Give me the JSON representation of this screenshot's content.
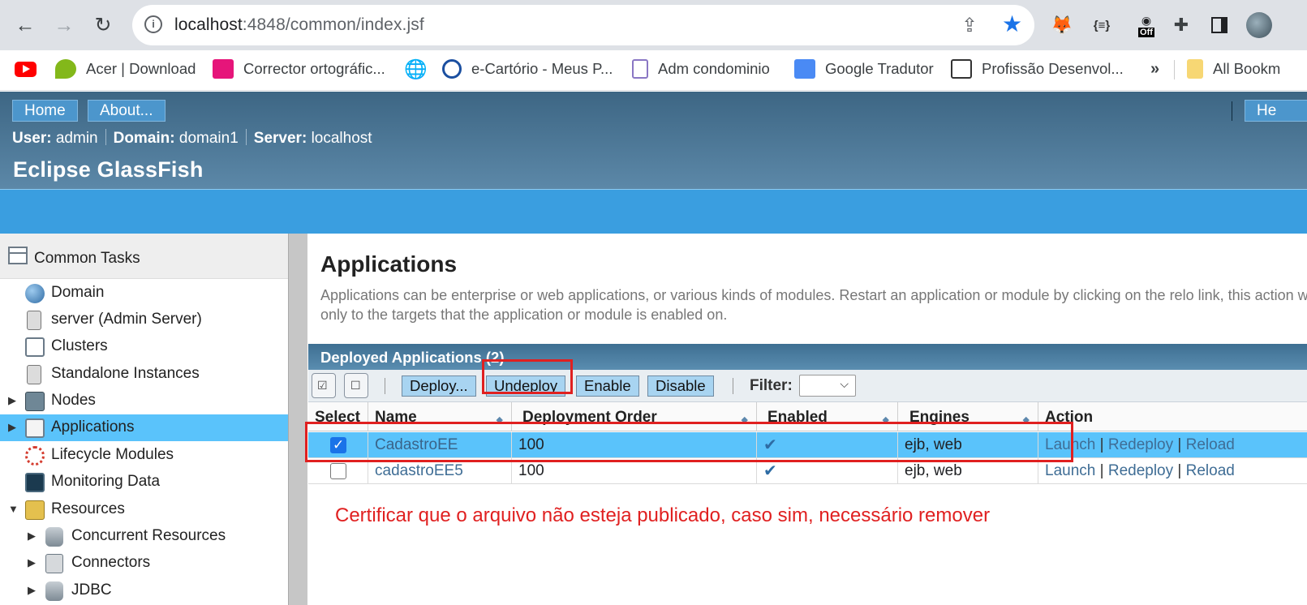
{
  "browser": {
    "url_host": "localhost",
    "url_rest": ":4848/common/index.jsf",
    "bookmarks": [
      {
        "label": "Acer | Download",
        "color": "#83b81a"
      },
      {
        "label": "Corrector ortográfic...",
        "color": "#e6157a"
      },
      {
        "label": "e-Cartório - Meus P...",
        "color": "#1b4fa0"
      },
      {
        "label": "Adm condominio",
        "color": "#8a77c4"
      },
      {
        "label": "Google Tradutor",
        "color": "#4a8af4"
      },
      {
        "label": "Profissão Desenvol...",
        "color": "#333333"
      }
    ],
    "more": "»",
    "all_bookmarks": "All Bookm",
    "ext_off": "Off",
    "ext_json": "{≡}"
  },
  "masthead": {
    "home": "Home",
    "about": "About...",
    "help": "He",
    "user_label": "User:",
    "user": "admin",
    "domain_label": "Domain:",
    "domain": "domain1",
    "server_label": "Server:",
    "server": "localhost",
    "brand": "Eclipse GlassFish"
  },
  "sidebar": {
    "header": "Common Tasks",
    "items": [
      {
        "label": "Domain"
      },
      {
        "label": "server (Admin Server)"
      },
      {
        "label": "Clusters"
      },
      {
        "label": "Standalone Instances"
      },
      {
        "label": "Nodes"
      },
      {
        "label": "Applications"
      },
      {
        "label": "Lifecycle Modules"
      },
      {
        "label": "Monitoring Data"
      },
      {
        "label": "Resources"
      },
      {
        "label": "Concurrent Resources"
      },
      {
        "label": "Connectors"
      },
      {
        "label": "JDBC"
      }
    ]
  },
  "main": {
    "title": "Applications",
    "help": "Applications can be enterprise or web applications, or various kinds of modules. Restart an application or module by clicking on the relo link, this action will apply only to the targets that the application or module is enabled on.",
    "table_title": "Deployed Applications (2)",
    "buttons": {
      "deploy": "Deploy...",
      "undeploy": "Undeploy",
      "enable": "Enable",
      "disable": "Disable"
    },
    "filter_label": "Filter:",
    "columns": [
      "Select",
      "Name",
      "Deployment Order",
      "Enabled",
      "Engines",
      "Action"
    ],
    "rows": [
      {
        "selected": true,
        "name": "CadastroEE",
        "order": "100",
        "enabled": "✔",
        "engines": "ejb, web",
        "launch": "Launch",
        "redeploy": "Redeploy",
        "reload": "Reload"
      },
      {
        "selected": false,
        "name": "cadastroEE5",
        "order": "100",
        "enabled": "✔",
        "engines": "ejb, web",
        "launch": "Launch",
        "redeploy": "Redeploy",
        "reload": "Reload"
      }
    ],
    "action_sep": "|"
  },
  "annotation": "Certificar que o arquivo não esteja publicado, caso sim, necessário remover"
}
